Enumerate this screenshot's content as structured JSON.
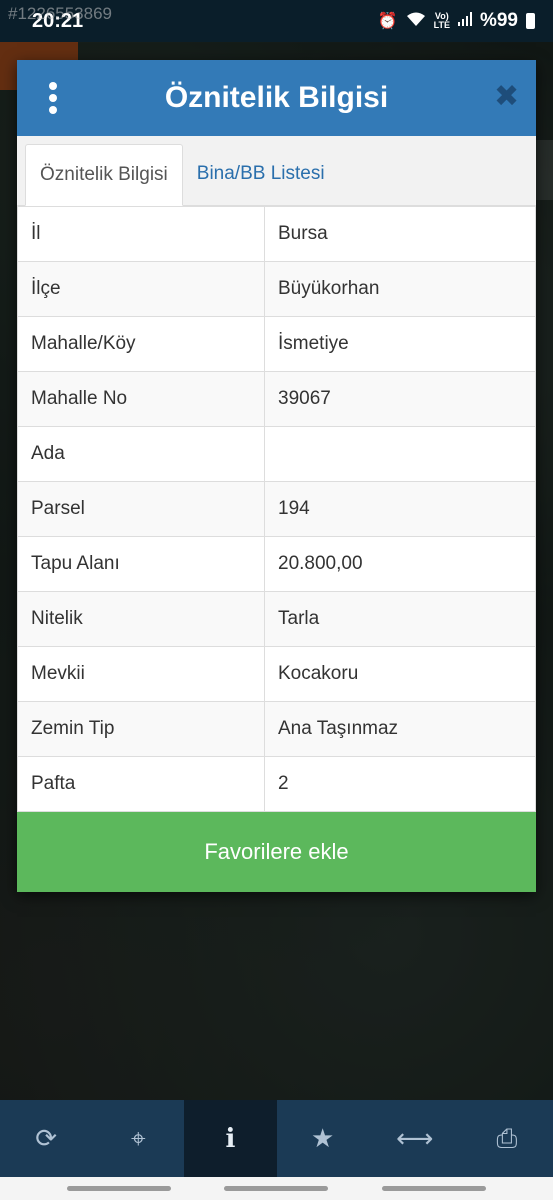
{
  "status_bar": {
    "time": "20:21",
    "watermark": "#1226553869",
    "battery": "%99",
    "icons": [
      "alarm-icon",
      "wifi-icon",
      "volte-icon",
      "signal-icon",
      "battery-icon"
    ]
  },
  "modal": {
    "title": "Öznitelik Bilgisi",
    "tabs": [
      {
        "label": "Öznitelik Bilgisi",
        "active": true
      },
      {
        "label": "Bina/BB Listesi",
        "active": false
      }
    ],
    "rows": [
      {
        "key": "İl",
        "value": "Bursa"
      },
      {
        "key": "İlçe",
        "value": "Büyükorhan"
      },
      {
        "key": "Mahalle/Köy",
        "value": "İsmetiye"
      },
      {
        "key": "Mahalle No",
        "value": "39067"
      },
      {
        "key": "Ada",
        "value": ""
      },
      {
        "key": "Parsel",
        "value": "194"
      },
      {
        "key": "Tapu Alanı",
        "value": "20.800,00"
      },
      {
        "key": "Nitelik",
        "value": "Tarla"
      },
      {
        "key": "Mevkii",
        "value": "Kocakoru"
      },
      {
        "key": "Zemin Tip",
        "value": "Ana Taşınmaz"
      },
      {
        "key": "Pafta",
        "value": "2"
      }
    ],
    "favorite_button": "Favorilere ekle"
  },
  "toolbar": {
    "items": [
      {
        "name": "refresh-icon",
        "glyph": "⟳"
      },
      {
        "name": "crosshair-icon",
        "glyph": "⌖"
      },
      {
        "name": "info-icon",
        "glyph": "i"
      },
      {
        "name": "star-icon",
        "glyph": "★"
      },
      {
        "name": "measure-icon",
        "glyph": "⟷"
      },
      {
        "name": "print-icon",
        "glyph": "⎙"
      }
    ],
    "active_index": 2
  },
  "colors": {
    "header": "#337ab7",
    "favorite": "#5cb85c",
    "toolbar": "#1b3a55"
  }
}
